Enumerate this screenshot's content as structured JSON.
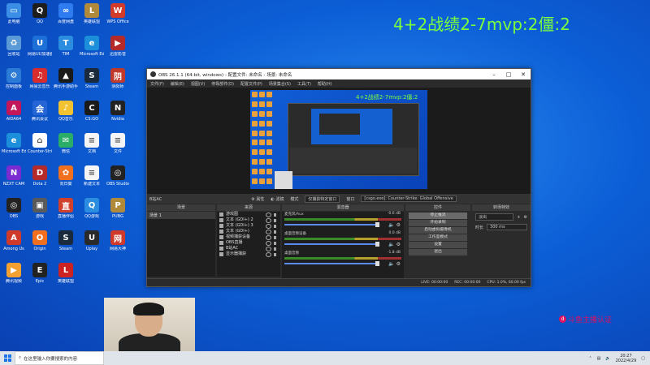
{
  "overlay": {
    "title": "4+2战绩2-7mvp:2僵:2"
  },
  "watermark": {
    "text": "斗鱼主播认证"
  },
  "desktop": {
    "icons": [
      {
        "label": "此电脑",
        "color": "#3a8ee6",
        "glyph": "▭"
      },
      {
        "label": "QQ",
        "color": "#1d1d1d",
        "glyph": "Q"
      },
      {
        "label": "百度网盘",
        "color": "#2f7bf0",
        "glyph": "∞"
      },
      {
        "label": "英雄联盟",
        "color": "#b08a3a",
        "glyph": "L"
      },
      {
        "label": "WPS Office",
        "color": "#d23a2a",
        "glyph": "W"
      },
      {
        "label": "回收站",
        "color": "#5a9ad6",
        "glyph": "♻"
      },
      {
        "label": "网易UU加速器",
        "color": "#1c6fd6",
        "glyph": "U"
      },
      {
        "label": "TIM",
        "color": "#2a8de0",
        "glyph": "T"
      },
      {
        "label": "Microsoft Edge",
        "color": "#1b8fd9",
        "glyph": "e"
      },
      {
        "label": "迅雷影音",
        "color": "#b42a2a",
        "glyph": "▶"
      },
      {
        "label": "控制面板",
        "color": "#2a7ad6",
        "glyph": "⚙"
      },
      {
        "label": "网易云音乐",
        "color": "#d92c2c",
        "glyph": "♫"
      },
      {
        "label": "腾讯手游助手",
        "color": "#1a1a1a",
        "glyph": "▲"
      },
      {
        "label": "Steam",
        "color": "#1b2a3a",
        "glyph": "S"
      },
      {
        "label": "阴阳师",
        "color": "#c0392b",
        "glyph": "阴"
      },
      {
        "label": "AIDA64",
        "color": "#c2185b",
        "glyph": "A"
      },
      {
        "label": "腾讯会议",
        "color": "#2565d6",
        "glyph": "会"
      },
      {
        "label": "QQ音乐",
        "color": "#f2c230",
        "glyph": "♪"
      },
      {
        "label": "CS:GO",
        "color": "#1a1a1a",
        "glyph": "C"
      },
      {
        "label": "Nvidia",
        "color": "#222",
        "glyph": "N"
      },
      {
        "label": "Microsoft Edge",
        "color": "#1b8fd9",
        "glyph": "e"
      },
      {
        "label": "Counter-Strike",
        "color": "#ffffff",
        "glyph": "⌂"
      },
      {
        "label": "微信",
        "color": "#2aae67",
        "glyph": "✉"
      },
      {
        "label": "文档",
        "color": "#f5f5f5",
        "glyph": "≡"
      },
      {
        "label": "文件",
        "color": "#f5f5f5",
        "glyph": "≡"
      },
      {
        "label": "NZXT CAM",
        "color": "#7a2cd0",
        "glyph": "N"
      },
      {
        "label": "Dota 2",
        "color": "#b42a2a",
        "glyph": "D"
      },
      {
        "label": "向日葵",
        "color": "#f07020",
        "glyph": "✿"
      },
      {
        "label": "新建文本",
        "color": "#f5f5f5",
        "glyph": "≡"
      },
      {
        "label": "OBS Studio",
        "color": "#222",
        "glyph": "◎"
      },
      {
        "label": "OBS",
        "color": "#222",
        "glyph": "◎"
      },
      {
        "label": "游戏",
        "color": "#5a5a5a",
        "glyph": "▣"
      },
      {
        "label": "直播伴侣",
        "color": "#d0402a",
        "glyph": "直"
      },
      {
        "label": "QQ游戏",
        "color": "#2a8de0",
        "glyph": "Q"
      },
      {
        "label": "PUBG",
        "color": "#b08a3a",
        "glyph": "P"
      },
      {
        "label": "Among Us",
        "color": "#d03a2a",
        "glyph": "A"
      },
      {
        "label": "Origin",
        "color": "#f07020",
        "glyph": "O"
      },
      {
        "label": "Steam",
        "color": "#1b2a3a",
        "glyph": "S"
      },
      {
        "label": "Uplay",
        "color": "#2a2a2a",
        "glyph": "U"
      },
      {
        "label": "网易大神",
        "color": "#d03a2a",
        "glyph": "网"
      },
      {
        "label": "腾讯视频",
        "color": "#f2a030",
        "glyph": "▶"
      },
      {
        "label": "Epic",
        "color": "#222",
        "glyph": "E"
      },
      {
        "label": "英雄联盟",
        "color": "#c22",
        "glyph": "L"
      }
    ]
  },
  "obs": {
    "title": "OBS 26.1.1 (64-bit, windows) - 配置文件: 未命名 - 场景: 未命名",
    "menu": [
      "文件(F)",
      "编辑(E)",
      "视图(V)",
      "停靠部件(D)",
      "配置文件(P)",
      "场景集合(S)",
      "工具(T)",
      "帮助(H)"
    ],
    "preview_title": "4+2战绩2-7mvp:2僵:2",
    "scene_bar": {
      "scene": "B站AC",
      "props": "属性",
      "filters": "滤镜",
      "mode_label": "模式",
      "mode_value": "仅捕获特定窗口",
      "window_label": "窗口",
      "window_value": "[csgo.exe]: Counter-Strike: Global Offensive"
    },
    "docks": {
      "scenes": {
        "title": "场景",
        "items": [
          "场景 1"
        ]
      },
      "sources": {
        "title": "来源",
        "items": [
          "游戏图",
          "文本 (GDI+) 2",
          "文本 (GDI+) 3",
          "文本 (GDI+)",
          "视频捕获设备",
          "OBS直播",
          "B站AC",
          "显示器捕获"
        ]
      },
      "mixer": {
        "title": "混音器",
        "channels": [
          {
            "name": "麦克风/Aux",
            "db": "-0.6 dB"
          },
          {
            "name": "桌面音频设备",
            "db": "0.0 dB"
          },
          {
            "name": "桌面音频",
            "db": "-1.8 dB"
          }
        ]
      },
      "controls": {
        "title": "控件",
        "buttons": [
          "停止推流",
          "开始录制",
          "启动虚拟摄像机",
          "工作室模式",
          "设置",
          "退出"
        ]
      },
      "transitions": {
        "title": "转场特效",
        "type": "淡出",
        "duration_label": "时长",
        "duration_value": "300 ms"
      }
    },
    "status": {
      "live": "LIVE: 00:00:00",
      "rec": "REC: 00:00:00",
      "cpu": "CPU: 1.0%, 60.00 fps"
    }
  },
  "taskbar": {
    "search_placeholder": "在这里输入你要搜索的内容",
    "time": "20:27",
    "date": "2022/4/29"
  }
}
